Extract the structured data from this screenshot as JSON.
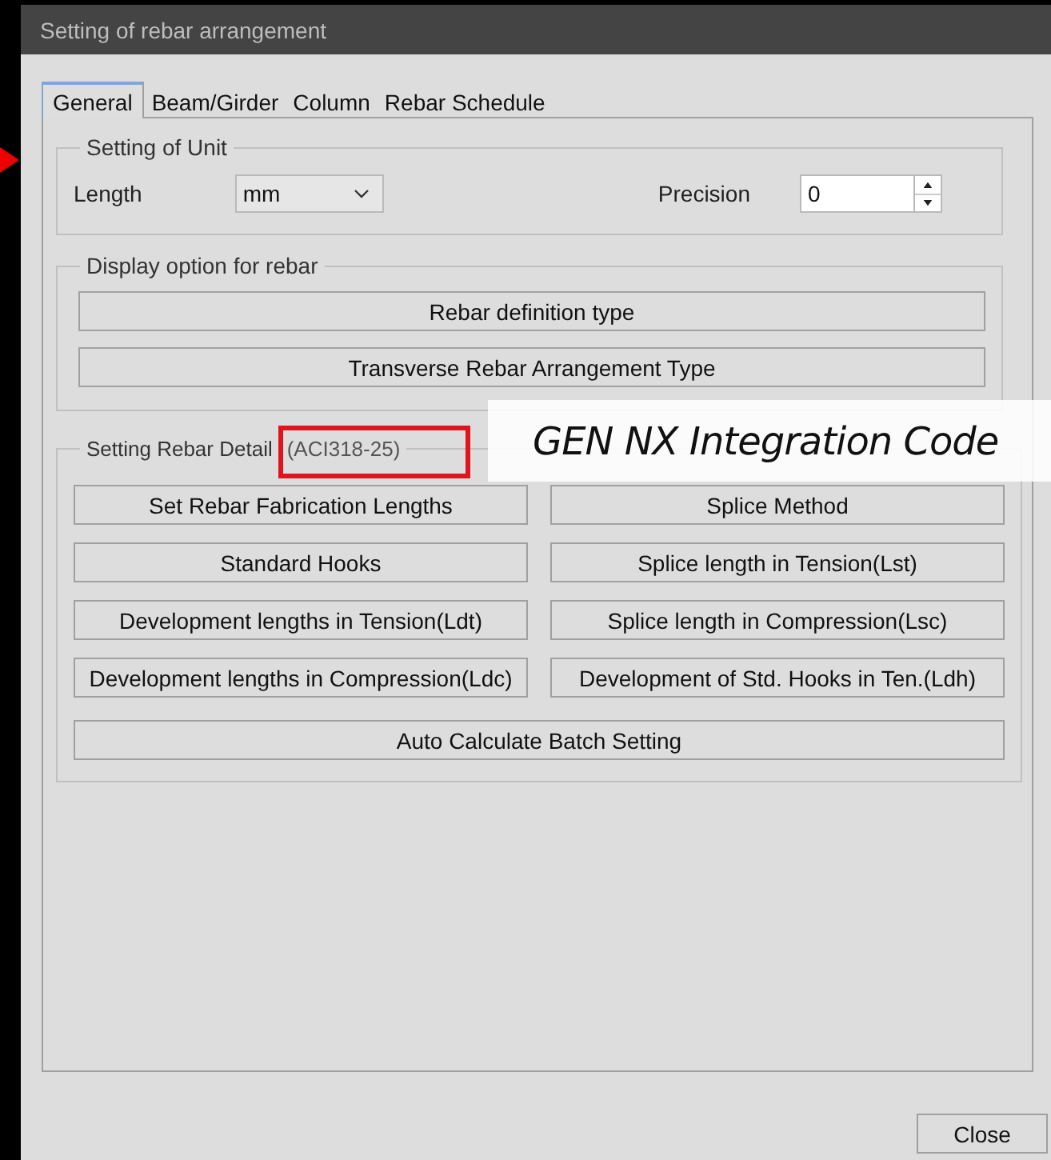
{
  "window": {
    "title": "Setting of rebar arrangement"
  },
  "tabs": [
    {
      "label": "General",
      "selected": true
    },
    {
      "label": "Beam/Girder",
      "selected": false
    },
    {
      "label": "Column",
      "selected": false
    },
    {
      "label": "Rebar Schedule",
      "selected": false
    }
  ],
  "unit_group": {
    "title": "Setting of Unit",
    "length_label": "Length",
    "length_value": "mm",
    "precision_label": "Precision",
    "precision_value": "0"
  },
  "display_group": {
    "title": "Display option for rebar",
    "buttons": [
      "Rebar definition type",
      "Transverse Rebar Arrangement Type"
    ]
  },
  "detail_group": {
    "title": "Setting Rebar Detail",
    "code": "(ACI318-25)",
    "buttons": [
      "Set Rebar Fabrication Lengths",
      "Splice Method",
      "Standard Hooks",
      "Splice length in Tension(Lst)",
      "Development lengths in Tension(Ldt)",
      "Splice length in Compression(Lsc)",
      "Development lengths in Compression(Ldc)",
      "Development of Std. Hooks in Ten.(Ldh)"
    ],
    "wide_button": "Auto Calculate Batch Setting"
  },
  "close_button": "Close",
  "callout": {
    "text": "GEN NX Integration Code"
  }
}
